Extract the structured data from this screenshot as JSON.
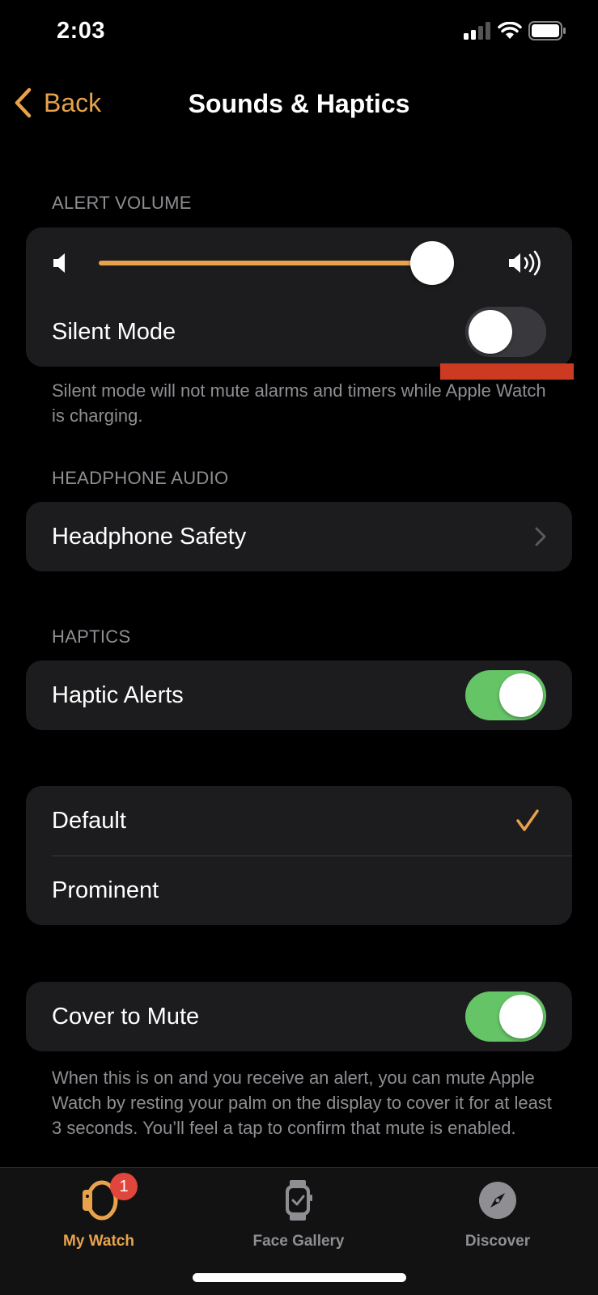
{
  "status_bar": {
    "time": "2:03",
    "signal_bars_active": 2,
    "signal_bars_total": 4
  },
  "nav": {
    "back_label": "Back",
    "title": "Sounds & Haptics"
  },
  "accent_color": "#e9a24c",
  "alert_volume": {
    "header": "ALERT VOLUME",
    "volume_level": 0.88,
    "silent_mode": {
      "label": "Silent Mode",
      "on": false
    },
    "footer": "Silent mode will not mute alarms and timers while Apple Watch is charging."
  },
  "headphone_audio": {
    "header": "HEADPHONE AUDIO",
    "headphone_safety_label": "Headphone Safety"
  },
  "haptics": {
    "header": "HAPTICS",
    "haptic_alerts": {
      "label": "Haptic Alerts",
      "on": true
    },
    "options": [
      {
        "label": "Default",
        "selected": true
      },
      {
        "label": "Prominent",
        "selected": false
      }
    ]
  },
  "cover_to_mute": {
    "label": "Cover to Mute",
    "on": true,
    "footer": "When this is on and you receive an alert, you can mute Apple Watch by resting your palm on the display to cover it for at least 3 seconds. You’ll feel a tap to confirm that mute is enabled."
  },
  "tab_bar": {
    "tabs": [
      {
        "label": "My Watch",
        "active": true,
        "badge": "1"
      },
      {
        "label": "Face Gallery",
        "active": false
      },
      {
        "label": "Discover",
        "active": false
      }
    ]
  }
}
